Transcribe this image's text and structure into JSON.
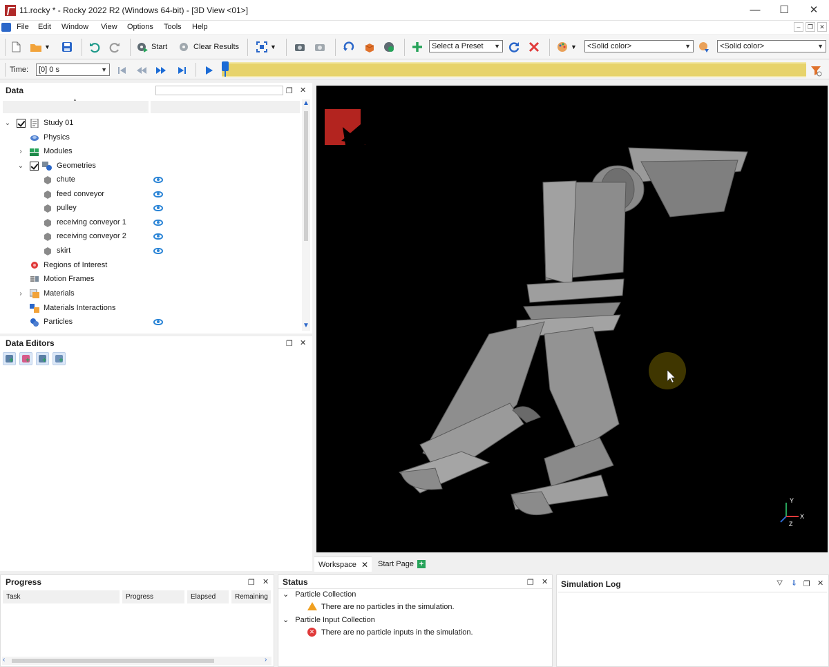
{
  "window": {
    "title": "11.rocky * - Rocky 2022 R2 (Windows 64-bit) - [3D View <01>]",
    "minimize": "—",
    "maximize": "☐",
    "close": "✕"
  },
  "menu": [
    "File",
    "Edit",
    "Window",
    "View",
    "Options",
    "Tools",
    "Help"
  ],
  "toolbar": {
    "start_label": "Start",
    "clear_results_label": "Clear Results",
    "preset_value": "Select a Preset",
    "color_combo_1": "<Solid color>",
    "color_combo_2": "<Solid color>"
  },
  "timebar": {
    "label": "Time:",
    "value": "[0] 0 s"
  },
  "data_panel": {
    "title": "Data",
    "tree": [
      {
        "label": "Study 01",
        "icon": "study-icon",
        "expanded": true,
        "checked": true
      },
      {
        "label": "Physics",
        "icon": "physics-icon"
      },
      {
        "label": "Modules",
        "icon": "modules-icon",
        "expanded": false
      },
      {
        "label": "Geometries",
        "icon": "geometries-icon",
        "expanded": true,
        "checked": true
      },
      {
        "label": "chute",
        "icon": "geometry-icon",
        "visible": true
      },
      {
        "label": "feed conveyor",
        "icon": "geometry-icon",
        "visible": true
      },
      {
        "label": "pulley",
        "icon": "geometry-icon",
        "visible": true
      },
      {
        "label": "receiving conveyor 1",
        "icon": "geometry-icon",
        "visible": true
      },
      {
        "label": "receiving conveyor 2",
        "icon": "geometry-icon",
        "visible": true
      },
      {
        "label": "skirt",
        "icon": "geometry-icon",
        "visible": true
      },
      {
        "label": "Regions of Interest",
        "icon": "regions-icon"
      },
      {
        "label": "Motion Frames",
        "icon": "motion-frames-icon"
      },
      {
        "label": "Materials",
        "icon": "materials-icon",
        "expanded": false
      },
      {
        "label": "Materials Interactions",
        "icon": "materials-interactions-icon"
      },
      {
        "label": "Particles",
        "icon": "particles-icon",
        "visible": true
      }
    ]
  },
  "data_editors": {
    "title": "Data Editors"
  },
  "view3d": {
    "background_color": "#000000",
    "axis_labels": {
      "y": "Y",
      "x": "X",
      "z": "Z"
    }
  },
  "workspace_tabs": [
    {
      "label": "Workspace",
      "active": true
    },
    {
      "label": "Start Page",
      "active": false
    }
  ],
  "progress_panel": {
    "title": "Progress",
    "columns": [
      "Task",
      "Progress",
      "Elapsed",
      "Remaining"
    ]
  },
  "status_panel": {
    "title": "Status",
    "groups": [
      {
        "label": "Particle Collection",
        "message": "There are no particles in the simulation.",
        "severity": "warning"
      },
      {
        "label": "Particle Input Collection",
        "message": "There are no particle inputs in the simulation.",
        "severity": "error"
      }
    ]
  },
  "simulation_log": {
    "title": "Simulation Log"
  },
  "colors": {
    "accent_blue": "#2b67c9",
    "timeline_yellow": "#e7d36b",
    "brand_red": "#b02a2a"
  }
}
